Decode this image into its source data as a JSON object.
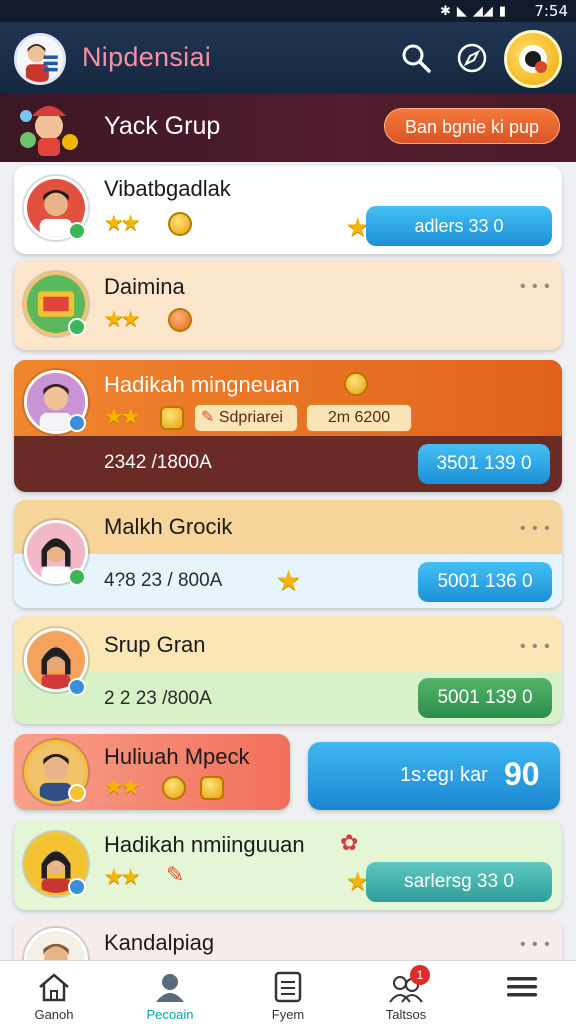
{
  "status_bar": {
    "time": "7:54"
  },
  "header": {
    "title": "Nipdensiai"
  },
  "group_banner": {
    "name": "Yack Grup",
    "cta_label": "Ban bgnie ki pup"
  },
  "list": [
    {
      "name": "Vibatbgadlak",
      "action_label": "adlers 33 0"
    },
    {
      "name": "Daimina"
    },
    {
      "name": "Hadikah mingneuan",
      "tag_label": "Sdpriarei",
      "tag_value": "2m 6200",
      "stat": "2342 /1800A",
      "action_label": "3501 139 0"
    },
    {
      "name": "Malkh Grocik",
      "stat": "4?8 23 / 800A",
      "action_label": "5001 136 0"
    },
    {
      "name": "Srup Gran",
      "stat": "2 2 23 /800A",
      "action_label": "5001 139 0"
    },
    {
      "name": "Huliuah Mpeck",
      "action_label": "1s:egı kar",
      "action_value": "90"
    },
    {
      "name": "Hadikah nmiinguuan",
      "action_label": "sarlersg 33 0"
    },
    {
      "name": "Kandalpiag"
    }
  ],
  "bottom_nav": [
    {
      "label": "Ganoh",
      "icon": "home-icon"
    },
    {
      "label": "Pecoain",
      "icon": "person-icon"
    },
    {
      "label": "Fyem",
      "icon": "document-icon"
    },
    {
      "label": "Taltsos",
      "icon": "group-icon",
      "badge": "1"
    },
    {
      "label": "",
      "icon": "menu-icon"
    }
  ],
  "colors": {
    "accent": "#0aa3a8",
    "header_bg": "#1f3553",
    "banner_bg": "#521d2c",
    "cta": "#dc5326"
  }
}
